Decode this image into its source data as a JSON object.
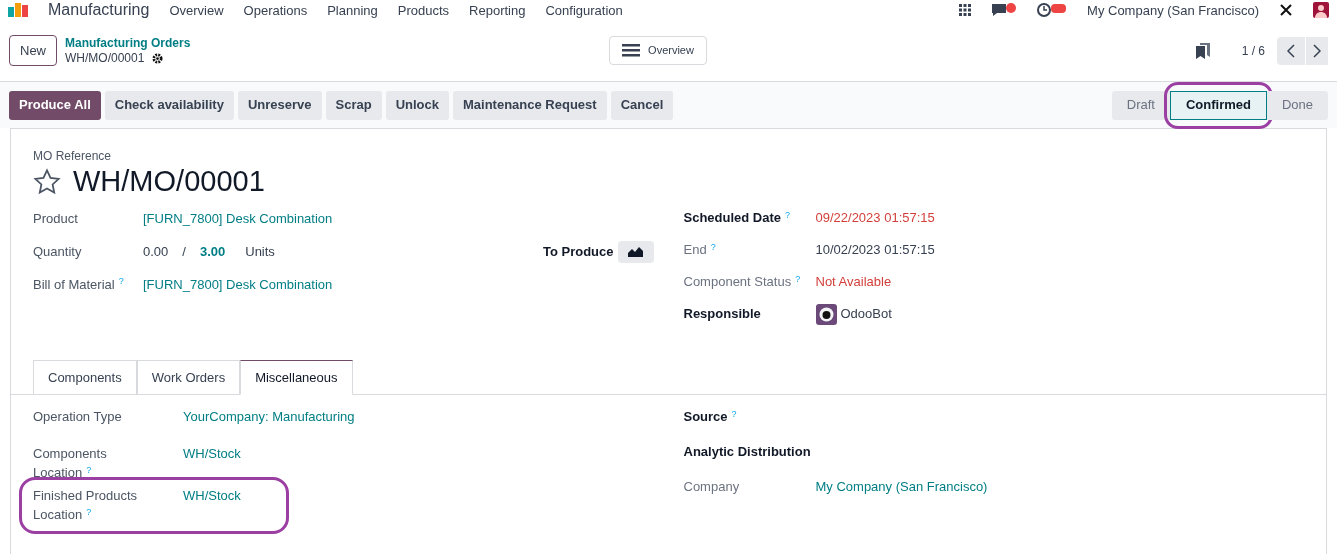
{
  "navbar": {
    "app": "Manufacturing",
    "menus": [
      "Overview",
      "Operations",
      "Planning",
      "Products",
      "Reporting",
      "Configuration"
    ],
    "company": "My Company (San Francisco)"
  },
  "control_panel": {
    "new_button": "New",
    "breadcrumb": "Manufacturing Orders",
    "record": "WH/MO/00001",
    "view_button": "Overview",
    "pager": "1 / 6"
  },
  "actions": [
    {
      "label": "Produce All",
      "primary": true
    },
    {
      "label": "Check availability",
      "primary": false
    },
    {
      "label": "Unreserve",
      "primary": false
    },
    {
      "label": "Scrap",
      "primary": false
    },
    {
      "label": "Unlock",
      "primary": false
    },
    {
      "label": "Maintenance Request",
      "primary": false
    },
    {
      "label": "Cancel",
      "primary": false
    }
  ],
  "status_steps": [
    {
      "label": "Draft",
      "selected": false,
      "circled": false
    },
    {
      "label": "Confirmed",
      "selected": true,
      "circled": true
    },
    {
      "label": "Done",
      "selected": false,
      "circled": false
    }
  ],
  "form": {
    "reference_label": "MO Reference",
    "title": "WH/MO/00001",
    "starred": false,
    "left_fields": [
      {
        "label": "Product",
        "kind": "link",
        "value": "[FURN_7800] Desk Combination"
      },
      {
        "label": "Quantity",
        "kind": "quantity",
        "produced": "0.00",
        "separator": "/",
        "target": "3.00",
        "unit": "Units",
        "side_label": "To Produce"
      },
      {
        "label": "Bill of Material",
        "help": "?",
        "kind": "link",
        "value": "[FURN_7800] Desk Combination"
      }
    ],
    "right_fields": [
      {
        "label": "Scheduled Date",
        "help": "?",
        "bold": true,
        "kind": "danger",
        "value": "09/22/2023 01:57:15"
      },
      {
        "label": "End",
        "help": "?",
        "bold": false,
        "kind": "plain",
        "value": "10/02/2023 01:57:15"
      },
      {
        "label": "Component Status",
        "help": "?",
        "bold": false,
        "kind": "danger",
        "value": "Not Available"
      },
      {
        "label": "Responsible",
        "bold": true,
        "kind": "avatar",
        "value": "OdooBot"
      }
    ],
    "tabs": [
      {
        "label": "Components",
        "selected": false
      },
      {
        "label": "Work Orders",
        "selected": false
      },
      {
        "label": "Miscellaneous",
        "selected": true
      }
    ],
    "misc_left": [
      {
        "label": "Operation Type",
        "value": "YourCompany: Manufacturing",
        "circled": false
      },
      {
        "label": "Components Location",
        "help": "?",
        "value": "WH/Stock",
        "circled": false
      },
      {
        "label": "Finished Products Location",
        "help": "?",
        "value": "WH/Stock",
        "circled": true
      }
    ],
    "misc_right": [
      {
        "label": "Source",
        "help": "?",
        "bold": true
      },
      {
        "label": "Analytic Distribution",
        "bold": true
      },
      {
        "label": "Company",
        "bold": false,
        "value": "My Company (San Francisco)"
      }
    ]
  }
}
